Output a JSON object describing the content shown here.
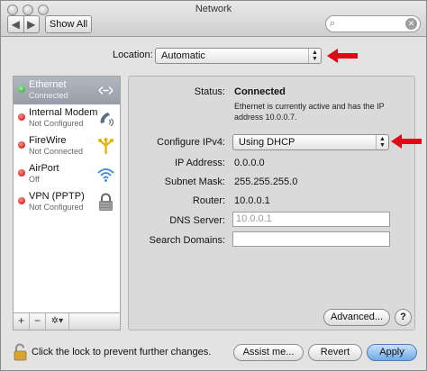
{
  "window": {
    "title": "Network"
  },
  "toolbar": {
    "back_glyph": "◀",
    "forward_glyph": "▶",
    "show_all_label": "Show All",
    "search_clear_glyph": "✕",
    "search_icon_glyph": "⌕"
  },
  "location": {
    "label": "Location:",
    "value": "Automatic",
    "arrows_up": "▲",
    "arrows_down": "▼"
  },
  "services": [
    {
      "name": "Ethernet",
      "status": "Connected",
      "indicator": "green",
      "icon": "ethernet-icon",
      "selected": true
    },
    {
      "name": "Internal Modem",
      "status": "Not Configured",
      "indicator": "red",
      "icon": "modem-icon",
      "selected": false
    },
    {
      "name": "FireWire",
      "status": "Not Connected",
      "indicator": "red",
      "icon": "firewire-icon",
      "selected": false
    },
    {
      "name": "AirPort",
      "status": "Off",
      "indicator": "red",
      "icon": "wifi-icon",
      "selected": false
    },
    {
      "name": "VPN (PPTP)",
      "status": "Not Configured",
      "indicator": "red",
      "icon": "vpn-lock-icon",
      "selected": false
    }
  ],
  "sidebar_buttons": {
    "add": "+",
    "remove": "−",
    "gear": "✲▾"
  },
  "detail": {
    "status_label": "Status:",
    "status_value": "Connected",
    "status_description": "Ethernet is currently active and has the IP address 10.0.0.7.",
    "configure_label": "Configure IPv4:",
    "configure_value": "Using DHCP",
    "ip_label": "IP Address:",
    "ip_value": "0.0.0.0",
    "subnet_label": "Subnet Mask:",
    "subnet_value": "255.255.255.0",
    "router_label": "Router:",
    "router_value": "10.0.0.1",
    "dns_label": "DNS Server:",
    "dns_value": "10.0.0.1",
    "search_domains_label": "Search Domains:",
    "search_domains_value": "",
    "advanced_label": "Advanced...",
    "help_label": "?"
  },
  "footer": {
    "lock_text": "Click the lock to prevent further changes.",
    "assist_label": "Assist me...",
    "revert_label": "Revert",
    "apply_label": "Apply"
  },
  "colors": {
    "annotation_arrow": "#e30613",
    "selection": "#9aa1ab",
    "primary_button": "#6fa9e6"
  }
}
